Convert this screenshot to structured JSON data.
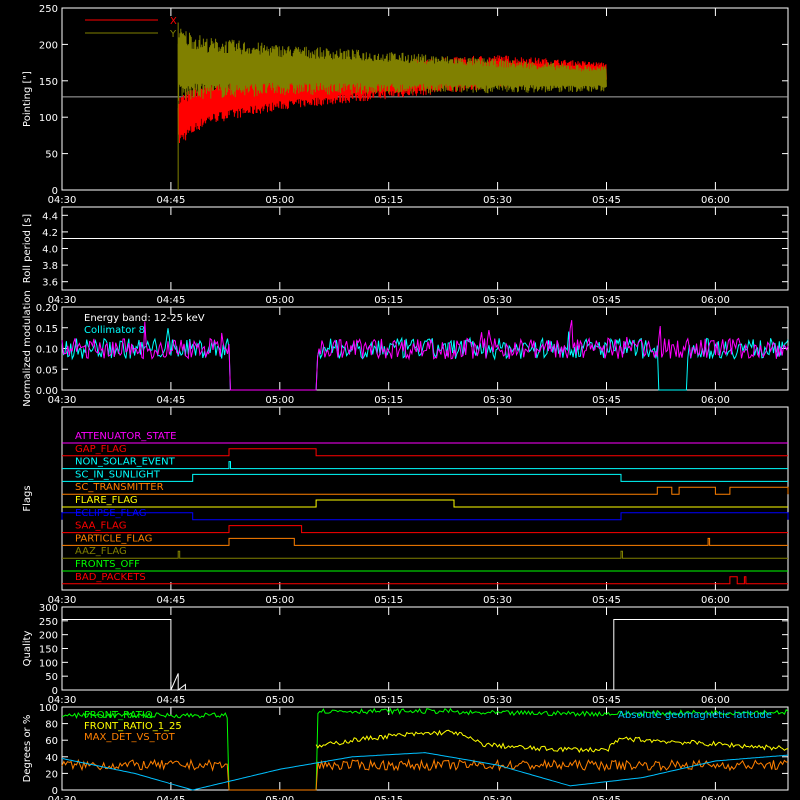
{
  "time_ticks": [
    "04:30",
    "04:45",
    "05:00",
    "05:15",
    "05:30",
    "05:45",
    "06:00"
  ],
  "colors": {
    "x_series": "#ff0000",
    "y_series": "#808000",
    "collimator": "#00ffff",
    "modulation": "#ff00ff",
    "front_ratio": "#00ff00",
    "front_ratio_1_25": "#ffff00",
    "max_det": "#ff8000",
    "geomag": "#00c0ff"
  },
  "chart_data": [
    {
      "id": "pointing",
      "type": "line",
      "ylabel": "Pointing [\"]",
      "ylim": [
        0,
        250
      ],
      "yticks": [
        "0",
        "50",
        "100",
        "150",
        "200",
        "250"
      ],
      "legend": [
        "X",
        "Y"
      ],
      "legend_placement": "top-left",
      "baseline": 128,
      "series": [
        {
          "name": "X",
          "color": "#ff0000",
          "envelope": {
            "t": [
              "04:46",
              "04:50",
              "05:00",
              "05:15",
              "05:30",
              "05:45"
            ],
            "upper": [
              130,
              150,
              160,
              178,
              186,
              175
            ],
            "lower": [
              60,
              90,
              110,
              125,
              140,
              150
            ]
          }
        },
        {
          "name": "Y",
          "color": "#808000",
          "envelope": {
            "t": [
              "04:46",
              "04:50",
              "05:00",
              "05:15",
              "05:30",
              "05:45"
            ],
            "upper": [
              225,
              210,
              200,
              190,
              180,
              170
            ],
            "lower": [
              120,
              125,
              130,
              132,
              133,
              135
            ]
          }
        }
      ],
      "data_range": [
        "04:46",
        "05:45"
      ]
    },
    {
      "id": "roll",
      "type": "line",
      "ylabel": "Roll period [s]",
      "ylim": [
        3.5,
        4.5
      ],
      "yticks": [
        "3.6",
        "3.8",
        "4.0",
        "4.2",
        "4.4"
      ],
      "series": [
        {
          "name": "",
          "color": "#ffffff",
          "x": [
            "04:30",
            "06:10"
          ],
          "y": [
            4.12,
            4.12
          ]
        }
      ]
    },
    {
      "id": "modulation",
      "type": "line",
      "ylabel": "Normalized modulation",
      "ylim": [
        0,
        0.2
      ],
      "yticks": [
        "0.00",
        "0.05",
        "0.10",
        "0.15",
        "0.20"
      ],
      "annotations": [
        "Energy band: 12-25 keV",
        "Collimator 8"
      ],
      "series": [
        {
          "name": "Collimator 8",
          "color": "#00ffff",
          "typical": 0.1,
          "gaps": [
            [
              "04:53",
              "05:05"
            ],
            [
              "05:52",
              "05:56"
            ]
          ]
        },
        {
          "name": "",
          "color": "#ff00ff",
          "typical": 0.1,
          "gaps": [
            [
              "04:53",
              "05:05"
            ]
          ]
        }
      ]
    },
    {
      "id": "flags",
      "type": "line",
      "ylabel": "Flags",
      "flags": [
        {
          "name": "ATTENUATOR_STATE",
          "color": "#ff00ff",
          "high": []
        },
        {
          "name": "GAP_FLAG",
          "color": "#ff0000",
          "high": [
            [
              "04:53",
              "05:05"
            ]
          ]
        },
        {
          "name": "NON_SOLAR_EVENT",
          "color": "#00ffff",
          "high": [
            [
              "04:53",
              "04:53"
            ]
          ]
        },
        {
          "name": "SC_IN_SUNLIGHT",
          "color": "#00ffff",
          "high": [
            [
              "04:48",
              "05:47"
            ]
          ]
        },
        {
          "name": "SC_TRANSMITTER",
          "color": "#ff8000",
          "high": [
            [
              "05:52",
              "05:54"
            ],
            [
              "05:55",
              "06:00"
            ],
            [
              "06:02",
              "06:10"
            ]
          ]
        },
        {
          "name": "FLARE_FLAG",
          "color": "#ffff00",
          "high": [
            [
              "05:05",
              "05:24"
            ]
          ]
        },
        {
          "name": "ECLIPSE_FLAG",
          "color": "#0000ff",
          "high": [
            [
              "04:30",
              "04:48"
            ],
            [
              "05:47",
              "06:10"
            ]
          ]
        },
        {
          "name": "SAA_FLAG",
          "color": "#ff0000",
          "high": [
            [
              "04:53",
              "05:03"
            ]
          ]
        },
        {
          "name": "PARTICLE_FLAG",
          "color": "#ff8000",
          "high": [
            [
              "04:53",
              "05:02"
            ],
            [
              "05:59",
              "05:59"
            ]
          ]
        },
        {
          "name": "AAZ_FLAG",
          "color": "#808000",
          "high": [
            [
              "04:46",
              "04:46"
            ],
            [
              "05:47",
              "05:47"
            ]
          ]
        },
        {
          "name": "FRONTS_OFF",
          "color": "#00ff00",
          "high": []
        },
        {
          "name": "BAD_PACKETS",
          "color": "#ff0000",
          "high": [
            [
              "06:02",
              "06:03"
            ],
            [
              "06:04",
              "06:04"
            ]
          ]
        }
      ]
    },
    {
      "id": "quality",
      "type": "line",
      "ylabel": "Quality",
      "ylim": [
        0,
        300
      ],
      "yticks": [
        "0",
        "50",
        "100",
        "150",
        "200",
        "250",
        "300"
      ],
      "series": [
        {
          "name": "",
          "color": "#ffffff",
          "x": [
            "04:30",
            "04:45",
            "04:45",
            "04:46",
            "04:46",
            "04:47",
            "04:47",
            "05:46",
            "05:46",
            "06:10"
          ],
          "y": [
            255,
            255,
            0,
            60,
            0,
            20,
            0,
            0,
            255,
            255
          ]
        }
      ]
    },
    {
      "id": "ratios",
      "type": "line",
      "ylabel": "Degrees or %",
      "ylim": [
        0,
        100
      ],
      "yticks": [
        "0",
        "20",
        "40",
        "60",
        "80",
        "100"
      ],
      "series": [
        {
          "name": "FRONT_RATIO",
          "color": "#00ff00",
          "x": [
            "04:30",
            "04:53",
            "05:05",
            "05:24",
            "05:24",
            "05:45",
            "06:10"
          ],
          "y": [
            90,
            90,
            95,
            95,
            93,
            92,
            94
          ]
        },
        {
          "name": "FRONT_RATIO_1_25",
          "color": "#ffff00",
          "x": [
            "05:05",
            "05:10",
            "05:15",
            "05:20",
            "05:24",
            "05:28",
            "05:35",
            "05:45",
            "05:47",
            "06:10"
          ],
          "y": [
            52,
            60,
            65,
            68,
            70,
            55,
            50,
            48,
            62,
            50
          ]
        },
        {
          "name": "MAX_DET_VS_TOT",
          "color": "#ff8000",
          "typical": 30,
          "gaps": [
            [
              "04:53",
              "05:05"
            ]
          ]
        },
        {
          "name": "Absolute geomagnetic latitude",
          "color": "#00c0ff",
          "x": [
            "04:30",
            "04:40",
            "04:48",
            "05:00",
            "05:10",
            "05:20",
            "05:30",
            "05:40",
            "05:50",
            "06:00",
            "06:10"
          ],
          "y": [
            38,
            20,
            0,
            25,
            40,
            45,
            30,
            5,
            15,
            35,
            42
          ]
        }
      ]
    }
  ]
}
